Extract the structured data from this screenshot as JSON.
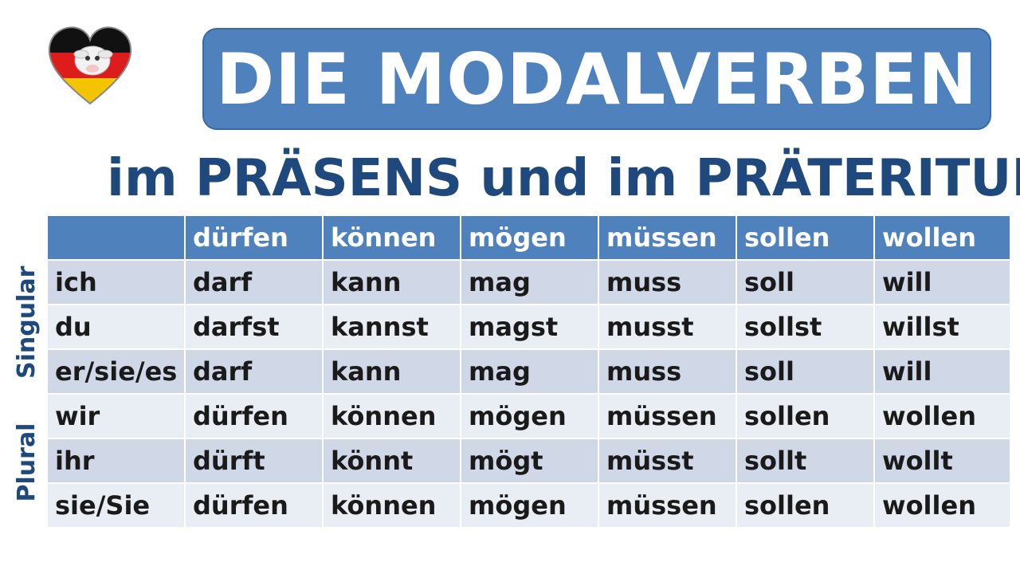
{
  "title": "DIE MODALVERBEN",
  "subtitle": "im PRÄSENS und im PRÄTERITUM",
  "side_labels": {
    "singular": "Singular",
    "plural": "Plural"
  },
  "table": {
    "headers": [
      "",
      "dürfen",
      "können",
      "mögen",
      "müssen",
      "sollen",
      "wollen"
    ],
    "rows": [
      [
        "ich",
        "darf",
        "kann",
        "mag",
        "muss",
        "soll",
        "will"
      ],
      [
        "du",
        "darfst",
        "kannst",
        "magst",
        "musst",
        "sollst",
        "willst"
      ],
      [
        "er/sie/es",
        "darf",
        "kann",
        "mag",
        "muss",
        "soll",
        "will"
      ],
      [
        "wir",
        "dürfen",
        "können",
        "mögen",
        "müssen",
        "sollen",
        "wollen"
      ],
      [
        "ihr",
        "dürft",
        "könnt",
        "mögt",
        "müsst",
        "sollt",
        "wollt"
      ],
      [
        "sie/Sie",
        "dürfen",
        "können",
        "mögen",
        "müssen",
        "sollen",
        "wollen"
      ]
    ]
  },
  "colors": {
    "accent": "#4f81bd",
    "text_dark_blue": "#1f497d",
    "row_dark": "#d0d8e8",
    "row_light": "#e9edf4"
  },
  "logo_icon": "german-flag-heart-sheep-icon"
}
